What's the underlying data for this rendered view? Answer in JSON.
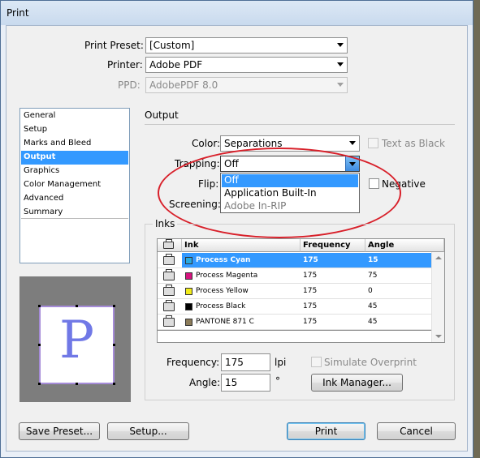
{
  "window": {
    "title": "Print"
  },
  "top": {
    "preset_label": "Print Preset:",
    "preset_value": "[Custom]",
    "printer_label": "Printer:",
    "printer_value": "Adobe PDF",
    "ppd_label": "PPD:",
    "ppd_value": "AdobePDF 8.0"
  },
  "sidebar": {
    "items": [
      {
        "label": "General"
      },
      {
        "label": "Setup"
      },
      {
        "label": "Marks and Bleed"
      },
      {
        "label": "Output"
      },
      {
        "label": "Graphics"
      },
      {
        "label": "Color Management"
      },
      {
        "label": "Advanced"
      },
      {
        "label": "Summary"
      }
    ],
    "selected": "Output"
  },
  "preview": {
    "page_letter": "P"
  },
  "output": {
    "section_title": "Output",
    "color_label": "Color:",
    "color_value": "Separations",
    "text_as_black_label": "Text as Black",
    "trapping_label": "Trapping:",
    "trapping_value": "Off",
    "flip_label": "Flip:",
    "negative_label": "Negative",
    "screening_label": "Screening:",
    "trapping_options": [
      "Off",
      "Application Built-In",
      "Adobe In-RIP"
    ]
  },
  "inks": {
    "section_title": "Inks",
    "columns": [
      "Ink",
      "Frequency",
      "Angle"
    ],
    "rows": [
      {
        "ink": "Process Cyan",
        "frequency": "175",
        "angle": "15",
        "color": "#29a9e0"
      },
      {
        "ink": "Process Magenta",
        "frequency": "175",
        "angle": "75",
        "color": "#d6137f"
      },
      {
        "ink": "Process Yellow",
        "frequency": "175",
        "angle": "0",
        "color": "#f2ec1a"
      },
      {
        "ink": "Process Black",
        "frequency": "175",
        "angle": "45",
        "color": "#000000"
      },
      {
        "ink": "PANTONE 871 C",
        "frequency": "175",
        "angle": "45",
        "color": "#8c7c5a"
      }
    ],
    "frequency_label": "Frequency:",
    "frequency_value": "175",
    "frequency_unit": "lpi",
    "angle_label": "Angle:",
    "angle_value": "15",
    "angle_unit": "°",
    "simulate_overprint_label": "Simulate Overprint",
    "ink_manager_label": "Ink Manager..."
  },
  "footer": {
    "save_preset_label": "Save Preset...",
    "setup_label": "Setup...",
    "print_label": "Print",
    "cancel_label": "Cancel"
  },
  "colors": {
    "selection": "#3399ff",
    "annotation": "#d8202a"
  }
}
